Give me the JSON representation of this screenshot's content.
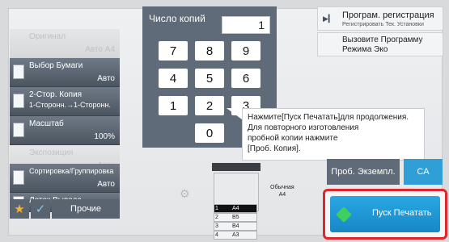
{
  "copies": {
    "label": "Число копий",
    "value": "1"
  },
  "keypad": {
    "keys": [
      "7",
      "8",
      "9",
      "4",
      "5",
      "6",
      "1",
      "2",
      "3",
      "0"
    ]
  },
  "left_panel": {
    "original": {
      "label": "Оригинал",
      "value": "Авто  A4"
    },
    "paper_select": {
      "label": "Выбор Бумаги",
      "value": "Авто"
    },
    "duplex": {
      "label": "2-Стор. Копия",
      "value": "1-Сторонн.→1-Сторонн."
    },
    "scale": {
      "label": "Масштаб",
      "value": "100%"
    },
    "exposure": {
      "label": "Экспозиция",
      "value": "Авто"
    },
    "sort": {
      "label": "Сортировка/Группировка",
      "value": "Авто"
    },
    "output_tray": {
      "label": "Лоток Вывода"
    },
    "other": {
      "label": "Прочие"
    }
  },
  "right_panel": {
    "program_registration": {
      "title": "Програм. регистрация",
      "subtitle": "Регистрировать Тек. Установки"
    },
    "eco_program": {
      "line1": "Вызовите Программу",
      "line2": "Режима Эко"
    },
    "tooltip": {
      "line1": "Нажмите[Пуск Печатать]для продолжения.",
      "line2": "Для повторного изготовления",
      "line3": "пробной копии нажмите",
      "line4": "[Проб. Копия]."
    },
    "proof_button": "Проб. Экземпл.",
    "ca_button": "CA",
    "start_button": "Пуск Печатать"
  },
  "machine": {
    "paper_type": "Обычная",
    "paper_size": "A4",
    "trays": [
      {
        "number": "1",
        "size": "A4",
        "selected": true
      },
      {
        "number": "2",
        "size": "B5",
        "selected": false
      },
      {
        "number": "3",
        "size": "B4",
        "selected": false
      },
      {
        "number": "4",
        "size": "A3",
        "selected": false
      }
    ]
  },
  "colors": {
    "accent": "#2f9fd6",
    "highlight_frame": "#e0262c",
    "button_dark": "#5f6b78"
  }
}
